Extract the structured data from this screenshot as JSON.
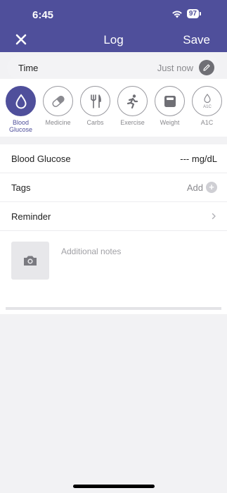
{
  "status": {
    "time": "6:45",
    "battery": "97"
  },
  "header": {
    "title": "Log",
    "save_label": "Save"
  },
  "time_row": {
    "label": "Time",
    "value": "Just now"
  },
  "categories": [
    {
      "label": "Blood Glucose",
      "icon": "drop-icon",
      "active": true
    },
    {
      "label": "Medicine",
      "icon": "pill-icon"
    },
    {
      "label": "Carbs",
      "icon": "fork-knife-icon"
    },
    {
      "label": "Exercise",
      "icon": "runner-icon"
    },
    {
      "label": "Weight",
      "icon": "scale-icon"
    },
    {
      "label": "A1C",
      "icon": "a1c-drop-icon",
      "icon_text": "A1C"
    }
  ],
  "form": {
    "glucose_label": "Blood Glucose",
    "glucose_value": "--- mg/dL",
    "tags_label": "Tags",
    "tags_add": "Add",
    "reminder_label": "Reminder",
    "notes_placeholder": "Additional notes"
  },
  "colors": {
    "brand": "#4f4f9b",
    "muted": "#8a8a8e"
  }
}
